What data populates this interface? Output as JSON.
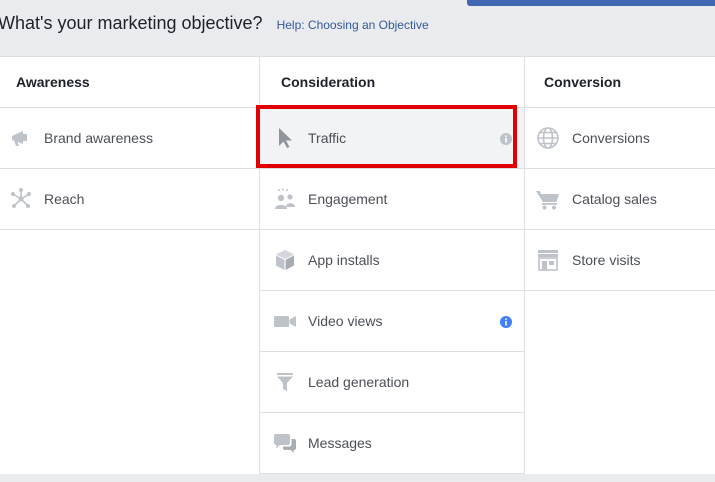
{
  "header": {
    "title": "What's your marketing objective?",
    "help_link": "Help: Choosing an Objective"
  },
  "columns": {
    "awareness": {
      "title": "Awareness",
      "items": [
        {
          "label": "Brand awareness",
          "icon": "megaphone-icon"
        },
        {
          "label": "Reach",
          "icon": "reach-network-icon"
        }
      ]
    },
    "consideration": {
      "title": "Consideration",
      "items": [
        {
          "label": "Traffic",
          "icon": "cursor-icon",
          "selected": true,
          "info": "grey"
        },
        {
          "label": "Engagement",
          "icon": "people-icon"
        },
        {
          "label": "App installs",
          "icon": "box-icon"
        },
        {
          "label": "Video views",
          "icon": "video-camera-icon",
          "info": "blue"
        },
        {
          "label": "Lead generation",
          "icon": "funnel-icon"
        },
        {
          "label": "Messages",
          "icon": "chat-bubbles-icon"
        }
      ]
    },
    "conversion": {
      "title": "Conversion",
      "items": [
        {
          "label": "Conversions",
          "icon": "globe-icon"
        },
        {
          "label": "Catalog sales",
          "icon": "shopping-cart-icon"
        },
        {
          "label": "Store visits",
          "icon": "storefront-icon"
        }
      ]
    }
  },
  "colors": {
    "icon": "#bec3c9",
    "info_blue": "#4080ff",
    "highlight": "#e00000",
    "link": "#365899"
  }
}
